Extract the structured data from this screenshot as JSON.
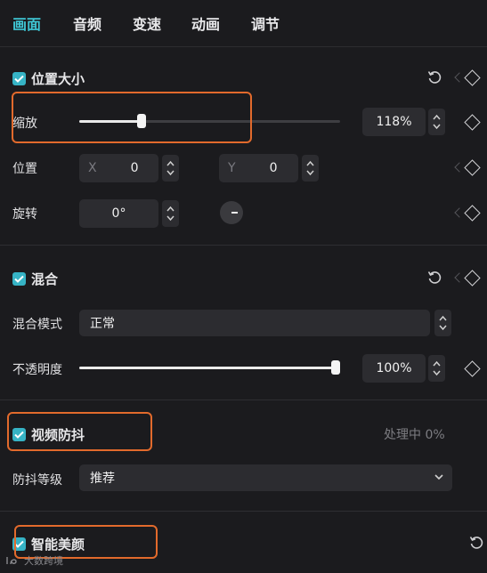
{
  "tabs": [
    "画面",
    "音频",
    "变速",
    "动画",
    "调节"
  ],
  "position_section": {
    "title": "位置大小",
    "scale_label": "缩放",
    "scale_value": "118%",
    "scale_level": 0.24,
    "position_label": "位置",
    "x_label": "X",
    "x_value": "0",
    "y_label": "Y",
    "y_value": "0",
    "rotate_label": "旋转",
    "rotate_value": "0°"
  },
  "blend_section": {
    "title": "混合",
    "mode_label": "混合模式",
    "mode_value": "正常",
    "opacity_label": "不透明度",
    "opacity_value": "100%",
    "opacity_level": 1.0
  },
  "stabilize_section": {
    "title": "视频防抖",
    "status": "处理中 0%",
    "level_label": "防抖等级",
    "level_value": "推荐"
  },
  "beauty_section": {
    "title": "智能美颜"
  },
  "watermark": "大数跨境",
  "colors": {
    "accent": "#3fc6d4",
    "checkbox": "#36b3c5",
    "highlight": "#e26a2c",
    "background": "#1b1b1e"
  }
}
